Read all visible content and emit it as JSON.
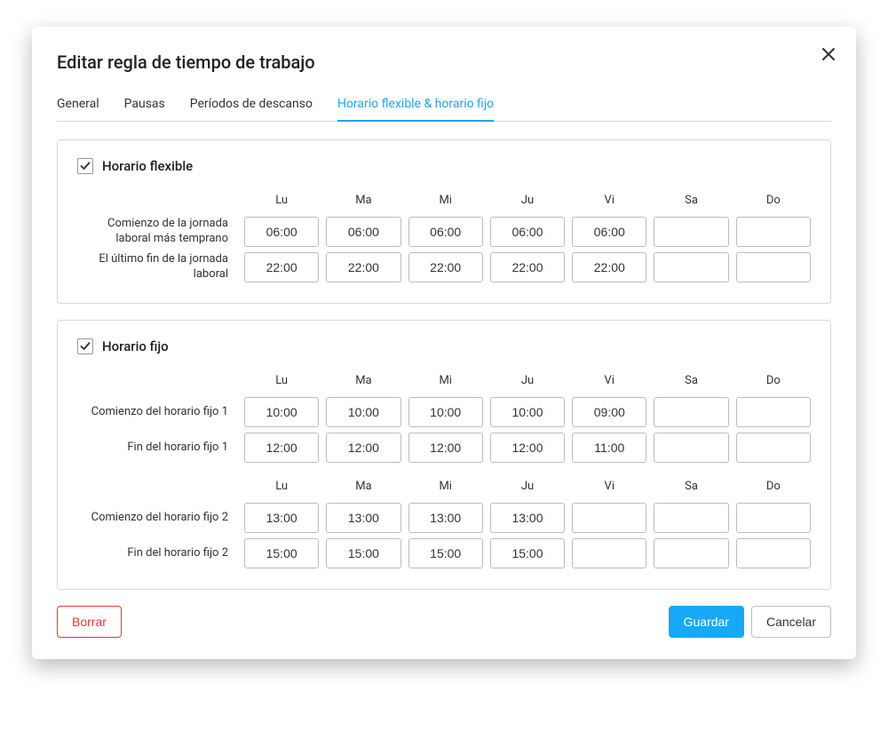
{
  "modal": {
    "title": "Editar regla de tiempo de trabajo"
  },
  "tabs": [
    "General",
    "Pausas",
    "Períodos de descanso",
    "Horario flexible & horario fijo"
  ],
  "activeTab": 3,
  "days": {
    "lu": "Lu",
    "ma": "Ma",
    "mi": "Mi",
    "ju": "Ju",
    "vi": "Vi",
    "sa": "Sa",
    "do": "Do"
  },
  "flexible": {
    "checked": true,
    "title": "Horario flexible",
    "labels": {
      "start": "Comienzo de la jornada laboral más temprano",
      "end": "El último fin de la jornada laboral"
    },
    "start": {
      "lu": "06:00",
      "ma": "06:00",
      "mi": "06:00",
      "ju": "06:00",
      "vi": "06:00",
      "sa": "",
      "do": ""
    },
    "end": {
      "lu": "22:00",
      "ma": "22:00",
      "mi": "22:00",
      "ju": "22:00",
      "vi": "22:00",
      "sa": "",
      "do": ""
    }
  },
  "fixed": {
    "checked": true,
    "title": "Horario fijo",
    "labels": {
      "start1": "Comienzo del horario fijo 1",
      "end1": "Fin del horario fijo 1",
      "start2": "Comienzo del horario fijo 2",
      "end2": "Fin del horario fijo 2"
    },
    "start1": {
      "lu": "10:00",
      "ma": "10:00",
      "mi": "10:00",
      "ju": "10:00",
      "vi": "09:00",
      "sa": "",
      "do": ""
    },
    "end1": {
      "lu": "12:00",
      "ma": "12:00",
      "mi": "12:00",
      "ju": "12:00",
      "vi": "11:00",
      "sa": "",
      "do": ""
    },
    "start2": {
      "lu": "13:00",
      "ma": "13:00",
      "mi": "13:00",
      "ju": "13:00",
      "vi": "",
      "sa": "",
      "do": ""
    },
    "end2": {
      "lu": "15:00",
      "ma": "15:00",
      "mi": "15:00",
      "ju": "15:00",
      "vi": "",
      "sa": "",
      "do": ""
    }
  },
  "buttons": {
    "delete": "Borrar",
    "save": "Guardar",
    "cancel": "Cancelar"
  }
}
